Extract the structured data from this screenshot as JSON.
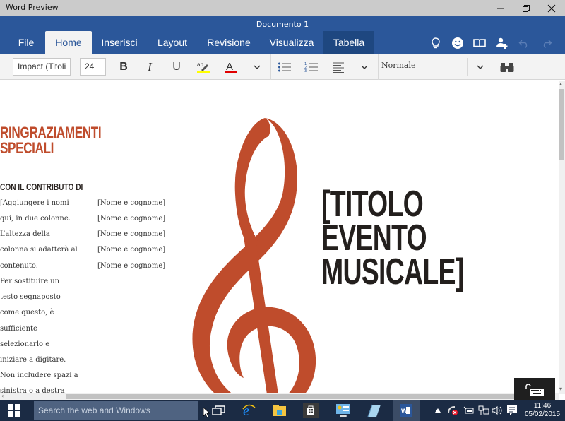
{
  "window": {
    "app_title": "Word Preview",
    "document_title": "Documento 1",
    "controls": {
      "minimize": "minimize",
      "maximize": "restore",
      "close": "close"
    }
  },
  "ribbon": {
    "tabs": [
      {
        "label": "File",
        "active": false
      },
      {
        "label": "Home",
        "active": true
      },
      {
        "label": "Inserisci",
        "active": false
      },
      {
        "label": "Layout",
        "active": false
      },
      {
        "label": "Revisione",
        "active": false
      },
      {
        "label": "Visualizza",
        "active": false
      },
      {
        "label": "Tabella",
        "active": false,
        "contextual": true
      }
    ],
    "header_icons": [
      "lightbulb-icon",
      "smiley-icon",
      "book-icon",
      "share-person-icon",
      "undo-icon",
      "redo-icon"
    ]
  },
  "toolbar": {
    "font_name": "Impact (Titoli",
    "font_size": "24",
    "bold": "B",
    "italic": "I",
    "underline": "U",
    "highlight_color": "#ffff00",
    "font_color": "#e00000",
    "style_value": "Normale"
  },
  "document": {
    "heading": [
      "RINGRAZIAMENTI",
      "SPECIALI"
    ],
    "subheading": "CON IL CONTRIBUTO DI",
    "left_column": [
      "[Aggiungere i nomi",
      "qui, in due colonne.",
      "L’altezza della",
      "colonna si adatterà al",
      "contenuto.",
      "Per sostituire un",
      "testo segnaposto",
      "come questo, è",
      "sufficiente",
      "selezionarlo e",
      "iniziare a digitare.",
      "Non includere spazi a",
      "sinistra o a destra"
    ],
    "right_column": [
      "[Nome e cognome]",
      "[Nome e cognome]",
      "[Nome e cognome]",
      "[Nome e cognome]",
      "[Nome e cognome]"
    ],
    "event_title": [
      "[TITOLO",
      "EVENTO",
      "MUSICALE]"
    ],
    "accent_color": "#bf4c2c",
    "title_color": "#231f1d"
  },
  "taskbar": {
    "search_placeholder": "Search the web and Windows",
    "apps": [
      "task-view-icon",
      "edge-icon",
      "file-explorer-icon",
      "store-icon",
      "control-panel-icon",
      "notepad-icon",
      "word-icon"
    ],
    "time": "11:46",
    "date": "05/02/2015"
  }
}
